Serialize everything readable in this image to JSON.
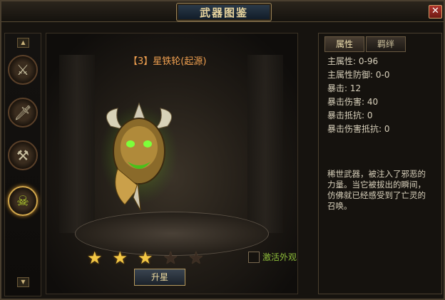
{
  "window": {
    "title": "武器图鉴"
  },
  "weapon": {
    "name": "【3】星铁轮(起源)",
    "stars_filled": 3,
    "stars_total": 5
  },
  "actions": {
    "upgrade_label": "升星",
    "activate_label": "激活外观"
  },
  "tabs": [
    "属性",
    "羁绊"
  ],
  "stats": [
    "主属性: 0-96",
    "主属性防御: 0-0",
    "暴击: 12",
    "暴击伤害: 40",
    "暴击抵抗: 0",
    "暴击伤害抵抗: 0"
  ],
  "description": "稀世武器，被注入了邪恶的力量。当它被拔出的瞬间，仿佛就已经感受到了亡灵的召唤。",
  "colors": {
    "star_on": "#f2c644",
    "name": "#f0a050",
    "activate": "#8fbf3a"
  }
}
